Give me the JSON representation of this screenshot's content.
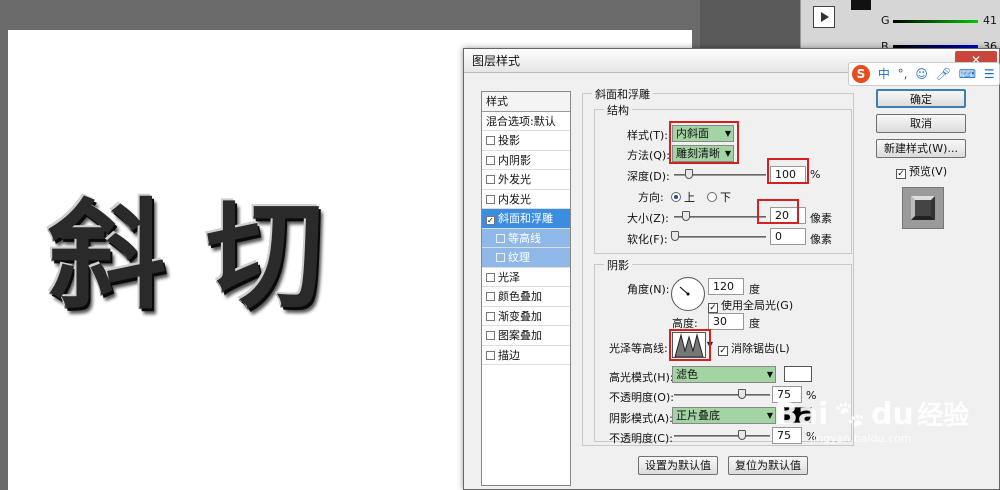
{
  "canvas": {
    "artwork_text": "斜切"
  },
  "top_panel": {
    "value_41": "41",
    "value_36": "36",
    "label_g": "G",
    "label_b": "B"
  },
  "dialog": {
    "title": "图层样式",
    "styles_header": "样式",
    "styles": [
      {
        "label": "混合选项:默认",
        "checkbox": false,
        "state": "normal"
      },
      {
        "label": "投影",
        "checkbox": true,
        "checked": false
      },
      {
        "label": "内阴影",
        "checkbox": true,
        "checked": false
      },
      {
        "label": "外发光",
        "checkbox": true,
        "checked": false
      },
      {
        "label": "内发光",
        "checkbox": true,
        "checked": false
      },
      {
        "label": "斜面和浮雕",
        "checkbox": true,
        "checked": true,
        "state": "selected"
      },
      {
        "label": "等高线",
        "checkbox": true,
        "checked": false,
        "state": "sub"
      },
      {
        "label": "纹理",
        "checkbox": true,
        "checked": false,
        "state": "sub"
      },
      {
        "label": "光泽",
        "checkbox": true,
        "checked": false
      },
      {
        "label": "颜色叠加",
        "checkbox": true,
        "checked": false
      },
      {
        "label": "渐变叠加",
        "checkbox": true,
        "checked": false
      },
      {
        "label": "图案叠加",
        "checkbox": true,
        "checked": false
      },
      {
        "label": "描边",
        "checkbox": true,
        "checked": false
      }
    ],
    "bevel": {
      "section_title": "斜面和浮雕",
      "structure_title": "结构",
      "style_label": "样式(T):",
      "style_value": "内斜面",
      "technique_label": "方法(Q):",
      "technique_value": "雕刻清晰",
      "depth_label": "深度(D):",
      "depth_value": "100",
      "depth_unit": "%",
      "direction_label": "方向:",
      "direction_up": "上",
      "direction_down": "下",
      "size_label": "大小(Z):",
      "size_value": "20",
      "size_unit": "像素",
      "soften_label": "软化(F):",
      "soften_value": "0",
      "soften_unit": "像素"
    },
    "shading": {
      "title": "阴影",
      "angle_label": "角度(N):",
      "angle_value": "120",
      "angle_unit": "度",
      "global_light_label": "使用全局光(G)",
      "altitude_label": "高度:",
      "altitude_value": "30",
      "altitude_unit": "度",
      "gloss_label": "光泽等高线:",
      "antialias_label": "消除锯齿(L)",
      "highlight_mode_label": "高光模式(H):",
      "highlight_mode_value": "滤色",
      "highlight_opacity_label": "不透明度(O):",
      "highlight_opacity_value": "75",
      "shadow_mode_label": "阴影模式(A):",
      "shadow_mode_value": "正片叠底",
      "shadow_opacity_label": "不透明度(C):",
      "shadow_opacity_value": "75",
      "percent": "%"
    },
    "buttons": {
      "ok": "确定",
      "cancel": "取消",
      "new_style": "新建样式(W)...",
      "preview": "预览(V)",
      "make_default": "设置为默认值",
      "reset_default": "复位为默认值"
    }
  },
  "ime": {
    "letter": "S",
    "text": "中",
    "punct": "°,"
  },
  "watermark": {
    "brand": "Bai",
    "brand2": "du",
    "product": "经验",
    "url": "jingyan.baidu.com"
  },
  "colors": {
    "accent": "#3b8de0",
    "red_highlight": "#d52020",
    "select_green": "#a3d4a3"
  }
}
